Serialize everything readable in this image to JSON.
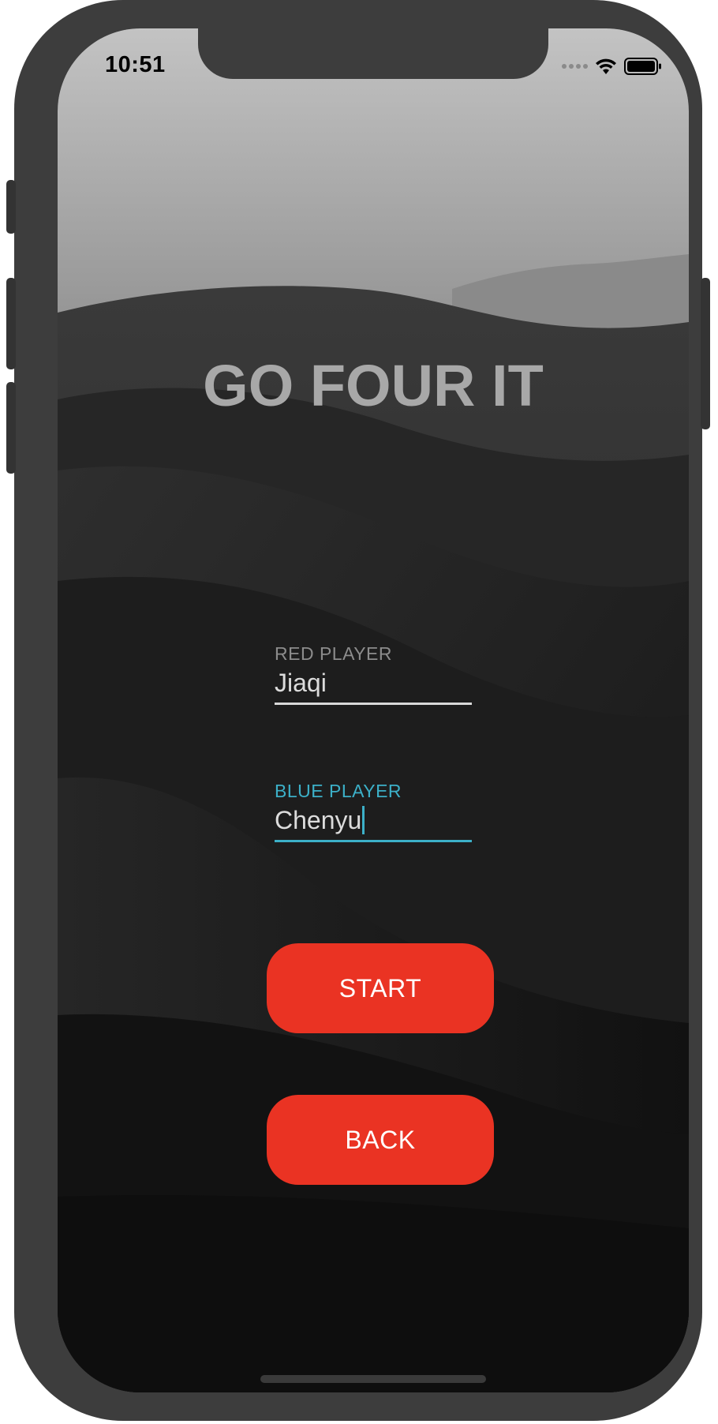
{
  "status_bar": {
    "time": "10:51"
  },
  "app": {
    "title": "GO FOUR IT"
  },
  "red_player": {
    "label": "RED PLAYER",
    "value": "Jiaqi"
  },
  "blue_player": {
    "label": "BLUE PLAYER",
    "value": "Chenyu"
  },
  "buttons": {
    "start": "START",
    "back": "BACK"
  },
  "colors": {
    "button": "#ea3323",
    "focus_accent": "#3cb0c8",
    "title": "#a8a8a8"
  },
  "icons": [
    "cellular-signal-icon",
    "wifi-icon",
    "battery-icon"
  ]
}
